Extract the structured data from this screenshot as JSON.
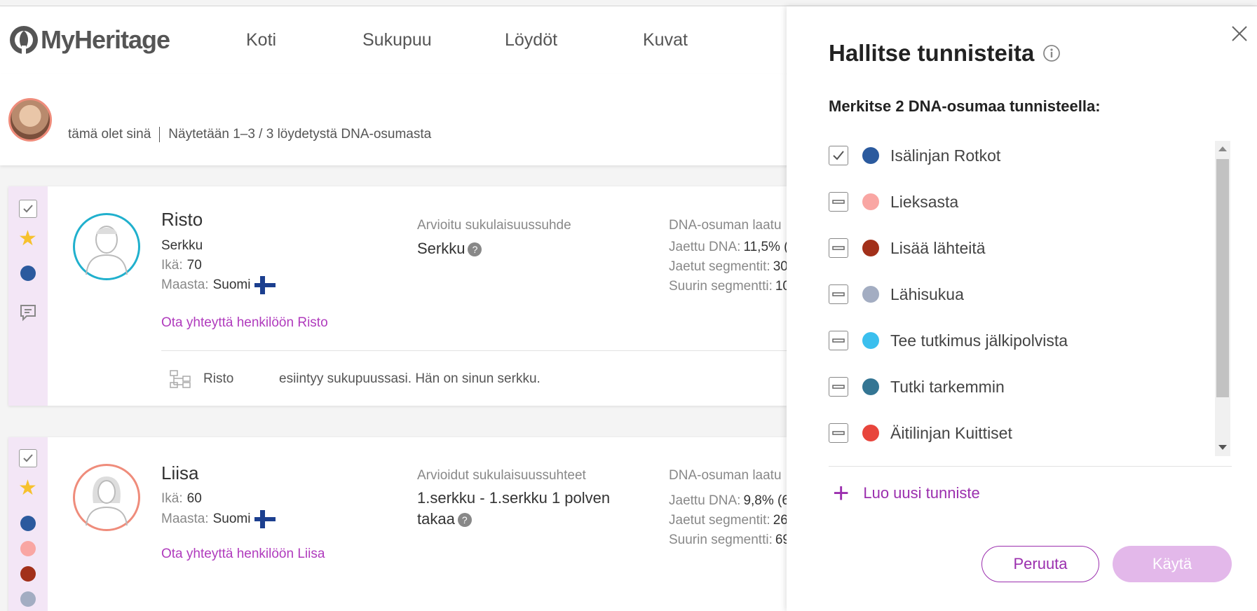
{
  "brand": {
    "name": "MyHeritage"
  },
  "nav": [
    "Koti",
    "Sukupuu",
    "Löydöt",
    "Kuvat"
  ],
  "summary": {
    "you_label": "tämä olet sinä",
    "count_text": "Näytetään 1–3 / 3 löydetystä DNA-osumasta"
  },
  "matches": [
    {
      "name": "Risto",
      "relation": "Serkku",
      "age_label": "Ikä:",
      "age": "70",
      "country_label": "Maasta:",
      "country": "Suomi",
      "contact": "Ota yhteyttä henkilöön Risto",
      "rel_heading": "Arvioitu sukulaisuussuhde",
      "rel_value": "Serkku",
      "dna_heading": "DNA-osuman laatu",
      "shared_dna_label": "Jaettu DNA:",
      "shared_dna": "11,5% (",
      "segments_label": "Jaetut segmentit:",
      "segments": "30",
      "largest_label": "Suurin segmentti:",
      "largest": "10",
      "tree_name": "Risto",
      "tree_text": "esiintyy sukupuussasi. Hän on sinun serkku.",
      "tag_colors": [
        "#2b5a9e"
      ]
    },
    {
      "name": "Liisa",
      "age_label": "Ikä:",
      "age": "60",
      "country_label": "Maasta:",
      "country": "Suomi",
      "contact": "Ota yhteyttä henkilöön Liisa",
      "rel_heading": "Arvioidut sukulaisuussuhteet",
      "rel_value": "1.serkku - 1.serkku 1 polven takaa",
      "dna_heading": "DNA-osuman laatu",
      "shared_dna_label": "Jaettu DNA:",
      "shared_dna": "9,8% (6",
      "segments_label": "Jaetut segmentit:",
      "segments": "26",
      "largest_label": "Suurin segmentti:",
      "largest": "69",
      "tag_colors": [
        "#2b5a9e",
        "#f9a6a3",
        "#a2301a",
        "#a3adc2"
      ]
    }
  ],
  "panel": {
    "title": "Hallitse tunnisteita",
    "subtitle": "Merkitse 2 DNA-osumaa tunnisteella:",
    "tags": [
      {
        "label": "Isälinjan Rotkot",
        "color": "#2b5a9e",
        "state": "checked"
      },
      {
        "label": "Lieksasta",
        "color": "#f9a6a3",
        "state": "mixed"
      },
      {
        "label": "Lisää lähteitä",
        "color": "#a2301a",
        "state": "mixed"
      },
      {
        "label": "Lähisukua",
        "color": "#a3adc2",
        "state": "mixed"
      },
      {
        "label": "Tee tutkimus jälkipolvista",
        "color": "#3bbfee",
        "state": "mixed"
      },
      {
        "label": "Tutki tarkemmin",
        "color": "#347593",
        "state": "mixed"
      },
      {
        "label": "Äitilinjan Kuittiset",
        "color": "#e8453c",
        "state": "mixed"
      }
    ],
    "create_label": "Luo uusi tunniste",
    "cancel_label": "Peruuta",
    "apply_label": "Käytä"
  },
  "colors": {
    "accent": "#9b2fae",
    "apply_disabled": "#e3b8ea",
    "star": "#f6c12d"
  }
}
